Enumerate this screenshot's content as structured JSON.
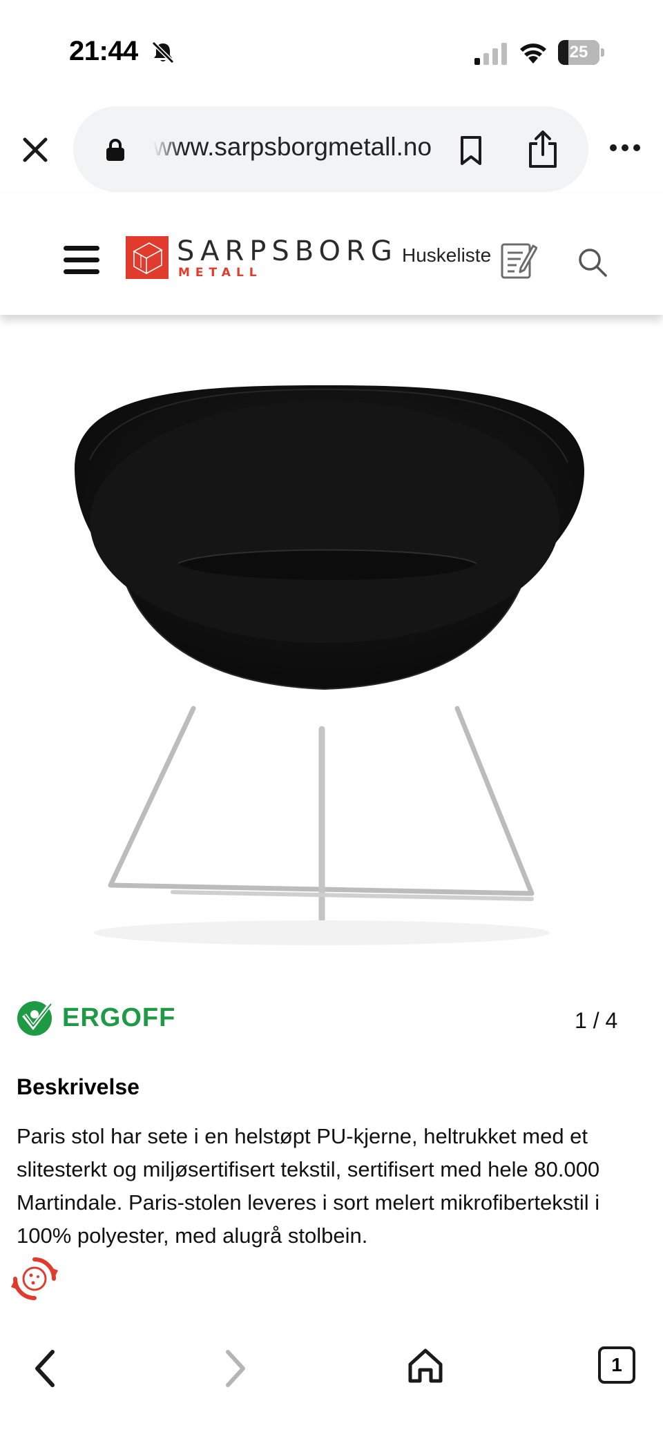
{
  "status_bar": {
    "time": "21:44",
    "battery": "25",
    "battery_level_percent": 25,
    "icons": [
      "bell-slash-icon",
      "cellular-signal-icon",
      "wifi-icon",
      "battery-icon"
    ]
  },
  "browser": {
    "url": "www.sarpsborgmetall.no",
    "icons": [
      "close-icon",
      "lock-icon",
      "bookmark-icon",
      "share-icon",
      "more-icon"
    ]
  },
  "header": {
    "logo_name": "SARPSBORG",
    "logo_sub": "METALL",
    "wishlist_label": "Huskeliste",
    "icons": [
      "hamburger-menu-icon",
      "wishlist-notepad-icon",
      "search-icon"
    ],
    "brand_color": "#e13b2d"
  },
  "product": {
    "image": "black-round-lounge-chair-image",
    "brand": "ERGOFF",
    "brand_color": "#1e9a45",
    "image_counter": "1 / 4",
    "description_title": "Beskrivelse",
    "description": "Paris stol har sete i en helstøpt PU-kjerne, heltrukket med et slitesterkt og miljøsertifisert tekstil, sertifisert med hele 80.000 Martindale. Paris-stolen leveres i sort melert mikrofibertekstil i 100% polyester, med alugrå stolbein."
  },
  "cookie_widget": {
    "icon": "cookie-settings-icon",
    "color": "#e13b2d"
  },
  "bottom_nav": {
    "tab_count": "1",
    "icons": [
      "back-arrow-icon",
      "forward-arrow-icon",
      "home-icon",
      "tabs-icon"
    ]
  }
}
